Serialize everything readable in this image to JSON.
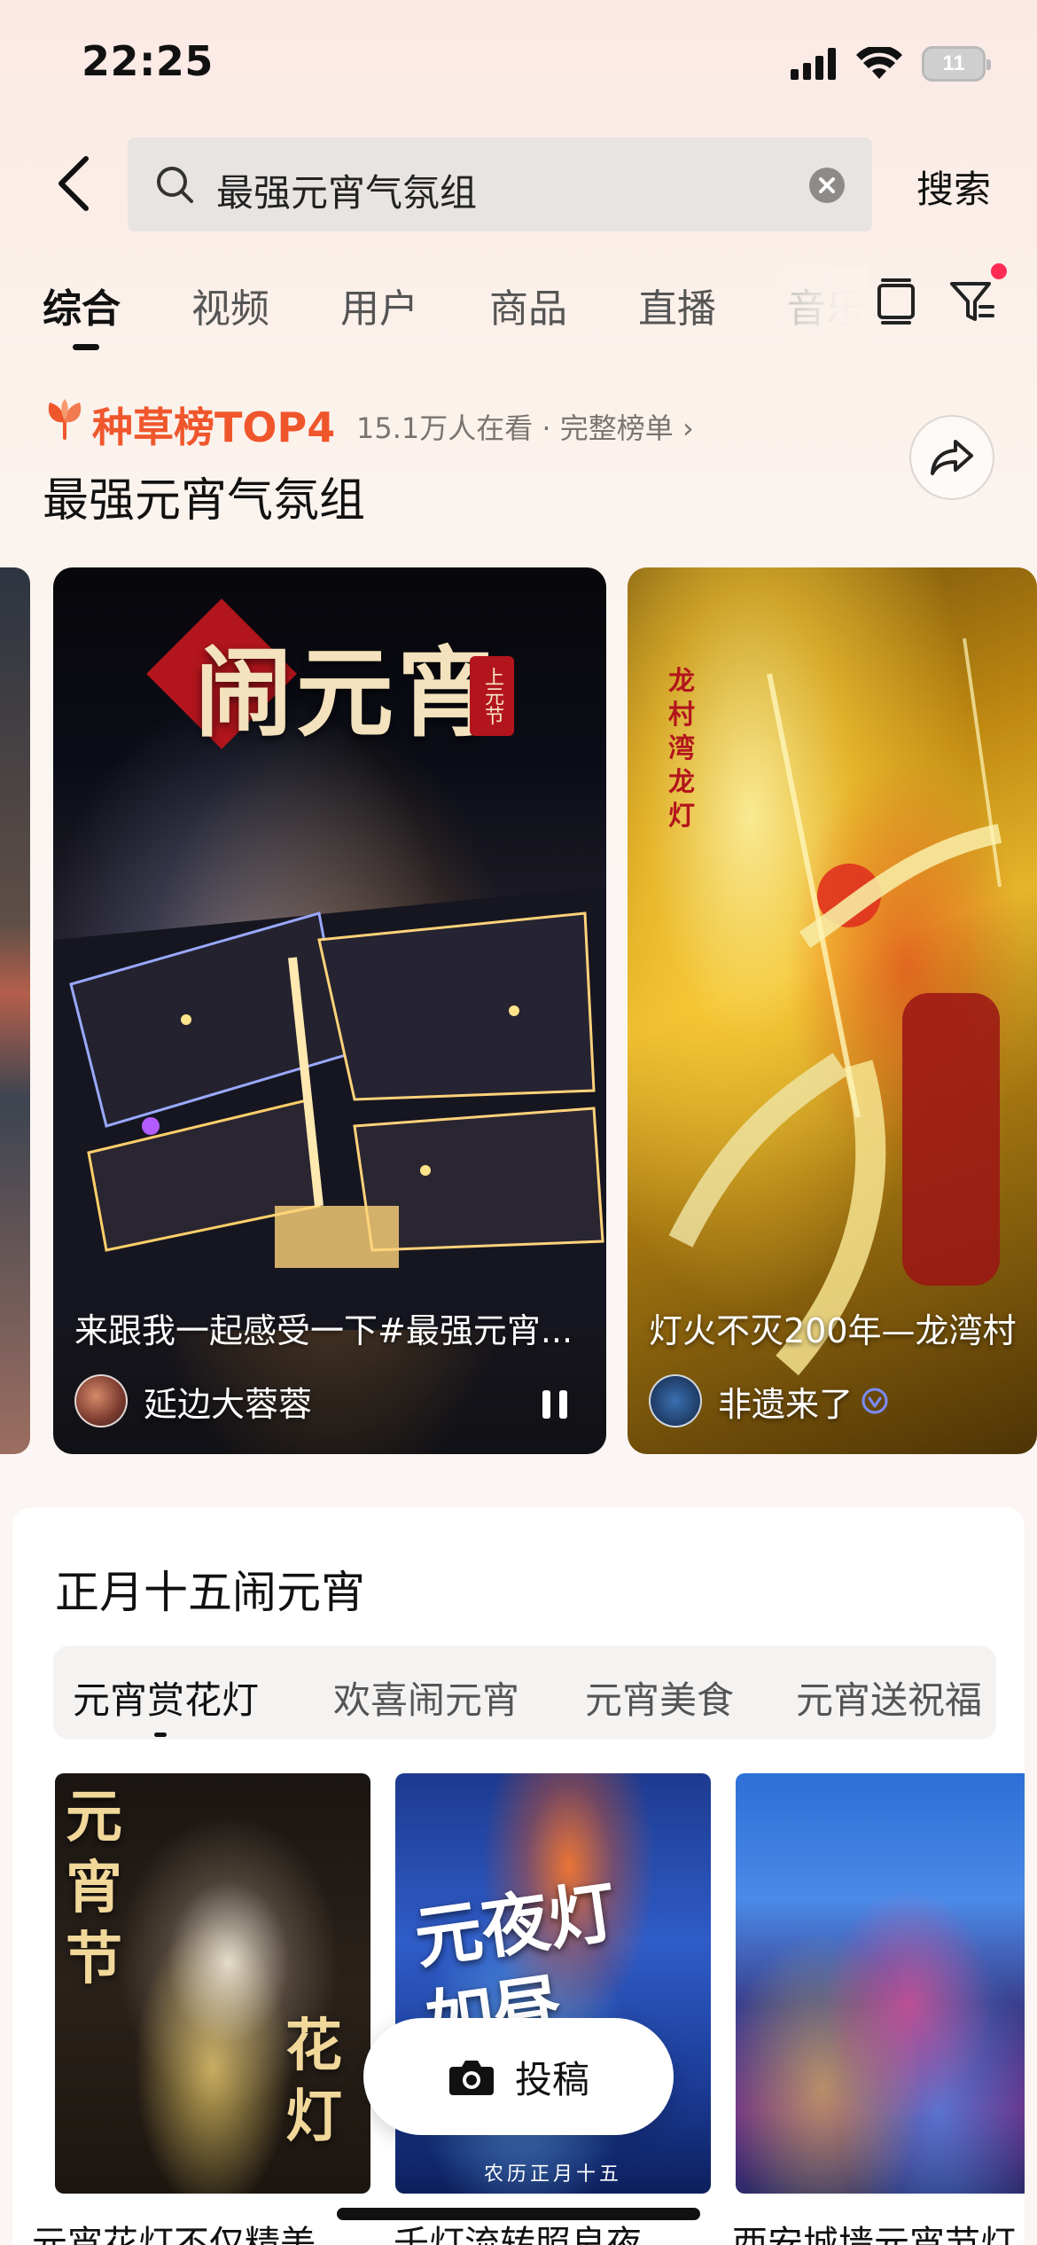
{
  "status_bar": {
    "time": "22:25",
    "battery": "11"
  },
  "search": {
    "query": "最强元宵气氛组",
    "submit_label": "搜索"
  },
  "tabs": [
    {
      "label": "综合",
      "active": true
    },
    {
      "label": "视频",
      "active": false
    },
    {
      "label": "用户",
      "active": false
    },
    {
      "label": "商品",
      "active": false
    },
    {
      "label": "直播",
      "active": false
    },
    {
      "label": "音乐",
      "active": false
    }
  ],
  "ranking": {
    "badge": "种草榜TOP4",
    "meta": "15.1万人在看 · 完整榜单 ›",
    "title": "最强元宵气氛组"
  },
  "video_cards": [
    {
      "art_title": "闹元宵",
      "seal_text": "上元节",
      "caption": "来跟我一起感受一下#最强元宵...",
      "author": "延边大蓉蓉",
      "verified": false,
      "playing": true
    },
    {
      "art_title": "龙村湾龙灯",
      "caption": "灯火不灭200年—龙湾村",
      "author": "非遗来了",
      "verified": true,
      "playing": false
    }
  ],
  "festival_section": {
    "title": "正月十五闹元宵",
    "subtabs": [
      {
        "label": "元宵赏花灯",
        "active": true
      },
      {
        "label": "欢喜闹元宵",
        "active": false
      },
      {
        "label": "元宵美食",
        "active": false
      },
      {
        "label": "元宵送祝福",
        "active": false
      }
    ],
    "thumbnails": [
      {
        "art_a": "元宵节",
        "art_b": "花灯",
        "caption": "元宵花灯不仅精美"
      },
      {
        "art": "元夜灯如昼",
        "bottom_text": "农历正月十五",
        "caption": "千灯流转照良夜"
      },
      {
        "caption": "西安城墙元宵节灯"
      }
    ]
  },
  "post_button": {
    "label": "投稿"
  },
  "colors": {
    "accent": "#f0562c",
    "notification_dot": "#fe2c55",
    "search_bg": "#e7e4e1",
    "verified": "#7b8cff"
  },
  "icons": [
    "back-arrow-icon",
    "search-icon",
    "clear-icon",
    "layers-icon",
    "filter-icon",
    "flower-icon",
    "share-icon",
    "pause-icon",
    "verified-icon",
    "camera-icon",
    "signal-icon",
    "wifi-icon",
    "battery-icon"
  ]
}
